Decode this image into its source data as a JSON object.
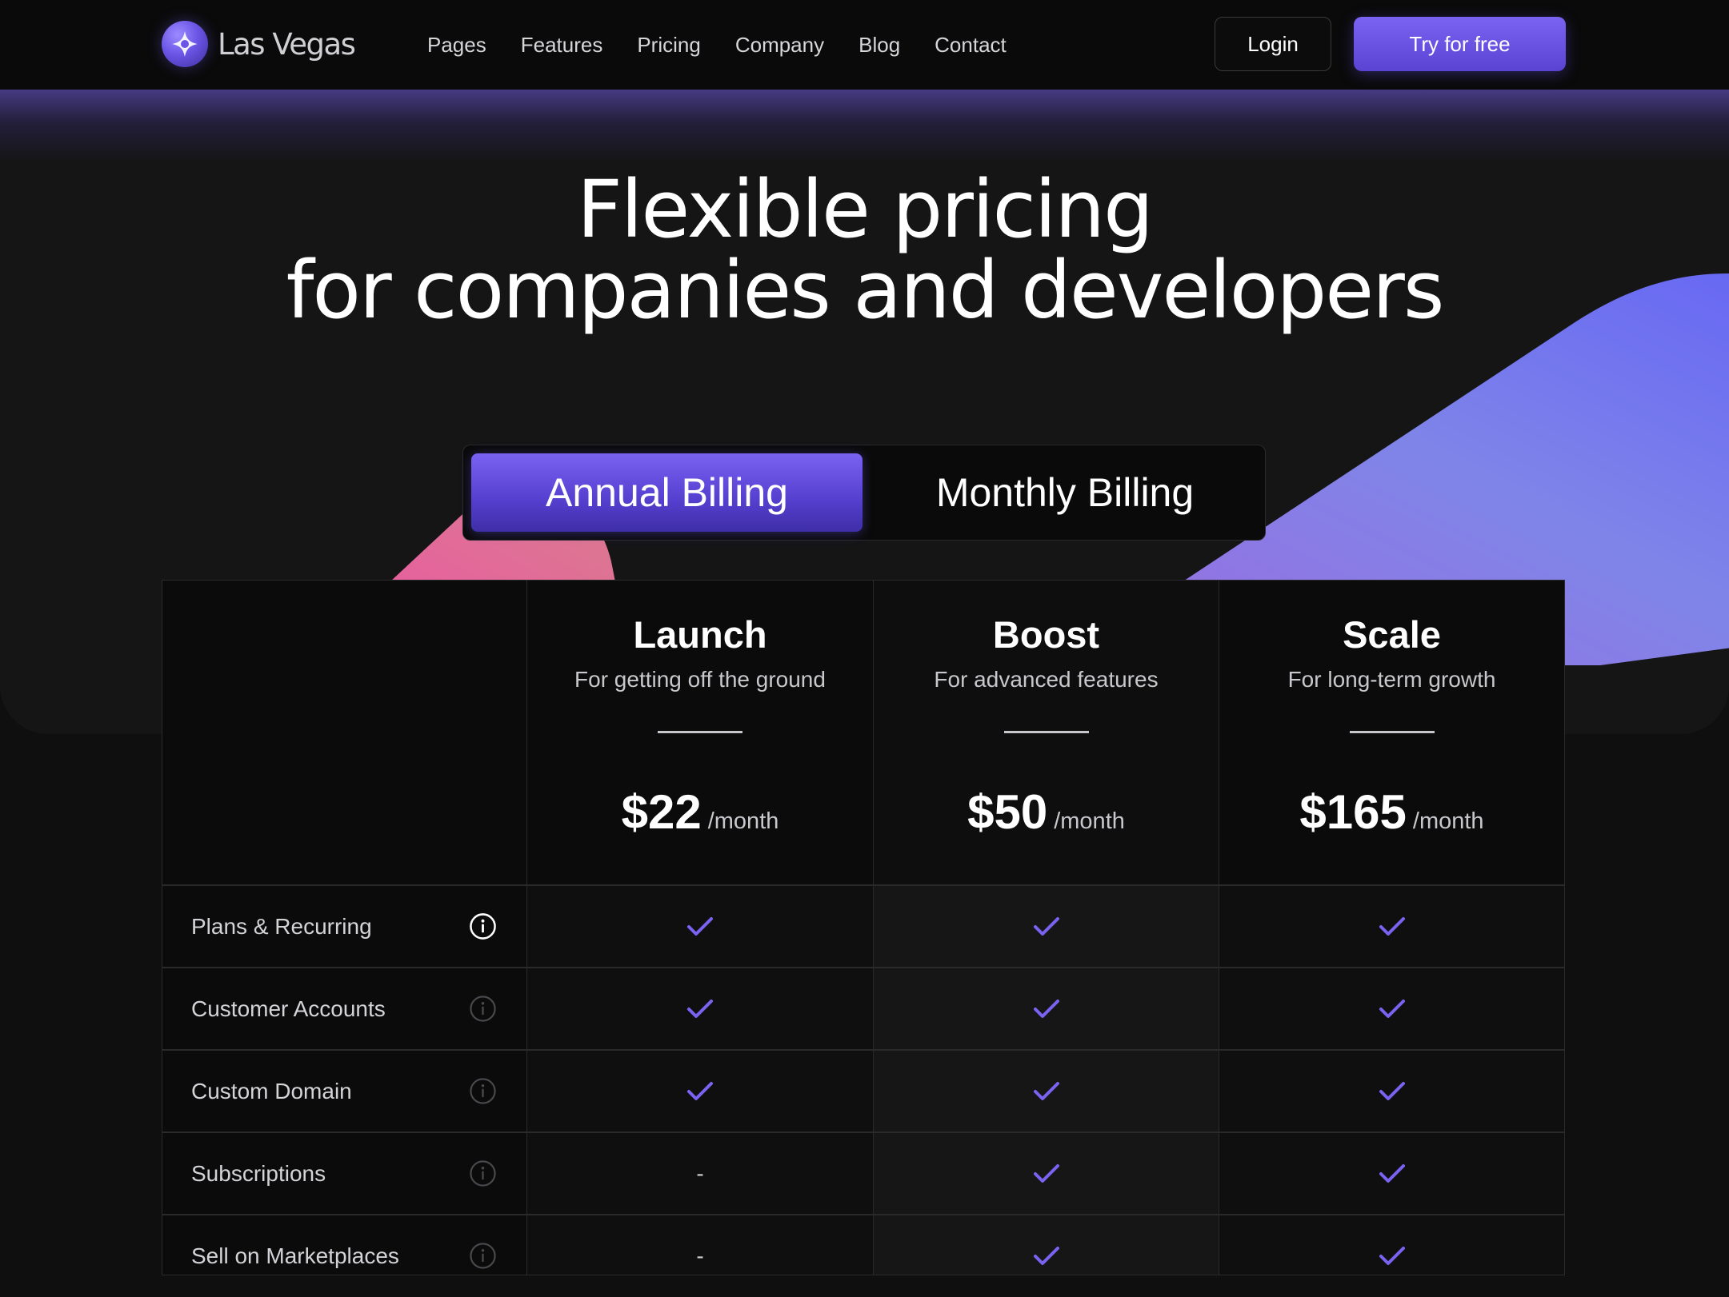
{
  "nav": {
    "brand": "Las Vegas",
    "links": [
      "Pages",
      "Features",
      "Pricing",
      "Company",
      "Blog",
      "Contact"
    ],
    "login_label": "Login",
    "try_label": "Try for free"
  },
  "hero": {
    "title_line1": "Flexible pricing",
    "title_line2": "for companies and developers"
  },
  "billing": {
    "annual_label": "Annual Billing",
    "monthly_label": "Monthly Billing",
    "selected": "annual"
  },
  "plans": [
    {
      "name": "Launch",
      "desc": "For getting off the ground",
      "price": "$22",
      "per": "/month"
    },
    {
      "name": "Boost",
      "desc": "For advanced features",
      "price": "$50",
      "per": "/month"
    },
    {
      "name": "Scale",
      "desc": "For long-term growth",
      "price": "$165",
      "per": "/month"
    }
  ],
  "features": [
    {
      "label": "Plans & Recurring",
      "values": [
        "check",
        "check",
        "check"
      ],
      "info_active": true
    },
    {
      "label": "Customer Accounts",
      "values": [
        "check",
        "check",
        "check"
      ],
      "info_active": false
    },
    {
      "label": "Custom Domain",
      "values": [
        "check",
        "check",
        "check"
      ],
      "info_active": false
    },
    {
      "label": "Subscriptions",
      "values": [
        "-",
        "check",
        "check"
      ],
      "info_active": false
    },
    {
      "label": "Sell on Marketplaces",
      "values": [
        "-",
        "check",
        "check"
      ],
      "info_active": false
    }
  ],
  "colors": {
    "accent": "#6a52e8",
    "check": "#7b63f2",
    "pink": "#e85aa8",
    "background": "#0f0f10"
  },
  "icons": {
    "info": "info-icon",
    "check": "check-icon",
    "logo": "sparkle-logo-icon"
  }
}
